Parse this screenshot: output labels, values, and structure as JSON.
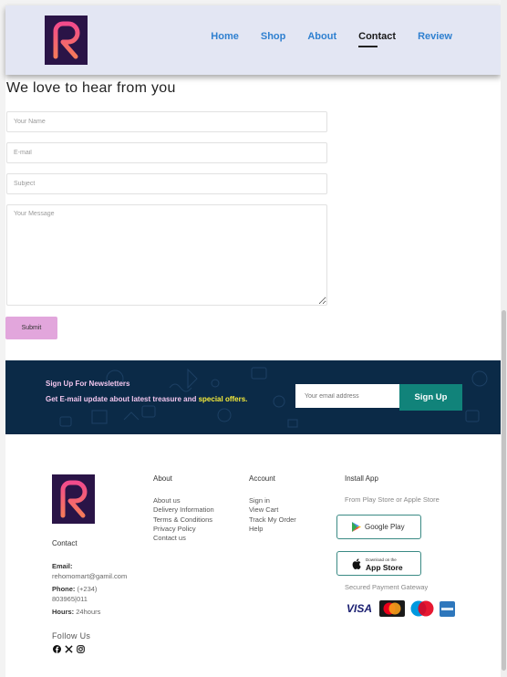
{
  "header": {
    "logo_letter": "R",
    "nav": [
      {
        "label": "Home",
        "active": false
      },
      {
        "label": "Shop",
        "active": false
      },
      {
        "label": "About",
        "active": false
      },
      {
        "label": "Contact",
        "active": true
      },
      {
        "label": "Review",
        "active": false
      }
    ]
  },
  "form": {
    "title": "We love to hear from you",
    "name_placeholder": "Your Name",
    "email_placeholder": "E-mail",
    "subject_placeholder": "Subject",
    "message_placeholder": "Your Message",
    "submit_label": "Submit"
  },
  "newsletter": {
    "title": "Sign Up For Newsletters",
    "subtitle_prefix": "Get E-mail update about latest treasure and ",
    "subtitle_highlight": "special offers.",
    "input_placeholder": "Your email address",
    "button_label": "Sign Up"
  },
  "footer": {
    "contact_heading": "Contact",
    "email_label": "Email:",
    "email_value": "rehomomart@gamil.com",
    "phone_label": "Phone:",
    "phone_value_1": "(+234)",
    "phone_value_2": "803965|011",
    "hours_label": "Hours:",
    "hours_value": "24hours",
    "follow_label": "Follow Us",
    "social_icons": [
      "facebook-icon",
      "x-icon",
      "instagram-icon"
    ],
    "about": {
      "heading": "About",
      "links": [
        "About us",
        "Delivery Information",
        "Terms & Conditions",
        "Privacy Policy",
        "Contact us"
      ]
    },
    "account": {
      "heading": "Account",
      "links": [
        "Sign in",
        "View Cart",
        "Track My Order",
        "Help"
      ]
    },
    "install": {
      "heading": "Install App",
      "subtitle": "From Play Store or Apple Store",
      "google_play_label": "Google Play",
      "app_store_small": "Download on the",
      "app_store_label": "App Store",
      "payment_heading": "Secured Payment Gateway",
      "payments": [
        "VISA",
        "MasterCard",
        "Maestro",
        "American Express"
      ]
    }
  },
  "colors": {
    "header_bg": "#e3e6f3",
    "nav_link": "#2f80d0",
    "submit_bg": "#e2a6dc",
    "newsletter_bg": "#0b2a47",
    "signup_button": "#11837a",
    "highlight": "#f7ec3a",
    "logo_bg": "#2a1447"
  }
}
